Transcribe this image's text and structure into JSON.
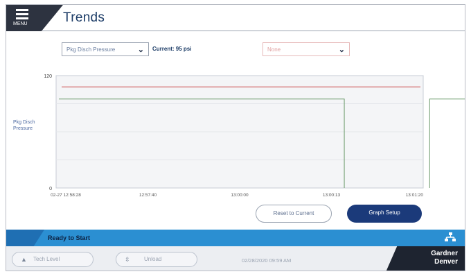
{
  "header": {
    "menu_label": "MENU",
    "title": "Trends"
  },
  "controls": {
    "parameter_select": "Pkg Disch Pressure",
    "current_value": "Current: 95 psi",
    "second_select": "None"
  },
  "chart_data": {
    "type": "line",
    "ylabel": "Pkg Disch Pressure",
    "ylim": [
      0,
      120
    ],
    "yticks": [
      "120",
      "0"
    ],
    "xticks": [
      "02-27 12:58:28",
      "12:57:40",
      "13:00:00",
      "13:00:13",
      "13:01:20"
    ],
    "grid": true,
    "series": [
      {
        "color": "#6a9a6a",
        "x": [
          0,
          1,
          2,
          3,
          4
        ],
        "y": [
          95,
          95,
          95,
          95,
          95
        ],
        "visible_ranges": [
          [
            0,
            3.14
          ],
          [
            4.07,
            4.92
          ]
        ]
      },
      {
        "color": "#c94a4a",
        "y_constant": 108
      }
    ]
  },
  "buttons": {
    "reset_zoom": "Reset to Current",
    "graph_setup": "Graph Setup"
  },
  "status": {
    "text": "Ready to Start"
  },
  "footer": {
    "pill1": "Tech Level",
    "pill2": "Unload",
    "datetime": "02/28/2020 09:59 AM",
    "logo_line1": "Gardner",
    "logo_line2": "Denver"
  },
  "colors": {
    "accent": "#2b8fd2",
    "dark": "#2d3340",
    "button": "#1b3a7a"
  }
}
